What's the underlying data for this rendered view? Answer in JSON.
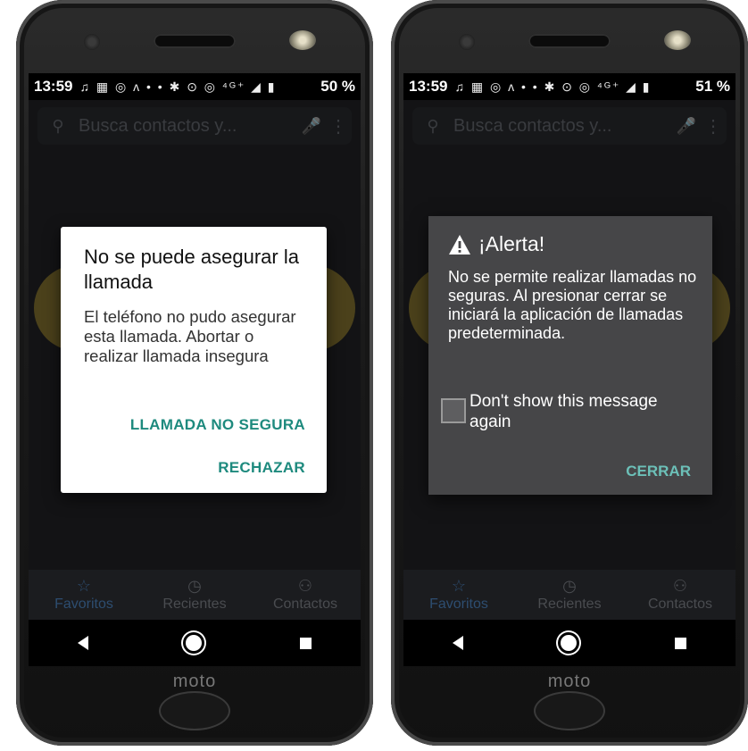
{
  "left_phone": {
    "status": {
      "time": "13:59",
      "icons": "♫ ▦ ◎ ᴧ •   • ✱ ⊙ ◎ ⁴ᴳ⁺ ◢ ▮",
      "battery": "50 %"
    },
    "search_placeholder": "Busca contactos y...",
    "dialog": {
      "title": "No se puede asegurar la llamada",
      "message": "El teléfono no pudo asegurar esta llamada. Abortar o realizar llamada insegura",
      "primary_button": "LLAMADA NO SEGURA",
      "secondary_button": "RECHAZAR",
      "accent_color": "#1e8a7e"
    },
    "bottom_nav": [
      {
        "label": "Favoritos",
        "icon": "star-icon",
        "glyph": "☆"
      },
      {
        "label": "Recientes",
        "icon": "clock-icon",
        "glyph": "◷"
      },
      {
        "label": "Contactos",
        "icon": "people-icon",
        "glyph": "⚇"
      }
    ],
    "brand": "moto"
  },
  "right_phone": {
    "status": {
      "time": "13:59",
      "icons": "♫ ▦ ◎ ᴧ •   • ✱ ⊙ ◎ ⁴ᴳ⁺ ◢ ▮",
      "battery": "51 %"
    },
    "search_placeholder": "Busca contactos y...",
    "dialog": {
      "title": "¡Alerta!",
      "message": "No se permite realizar llamadas no seguras. Al presionar cerrar se iniciará la aplicación de llamadas predeterminada.",
      "checkbox_label": "Don't show this message again",
      "checkbox_checked": false,
      "button": "CERRAR",
      "accent_color": "#6cc0b8"
    },
    "bottom_nav": [
      {
        "label": "Favoritos",
        "icon": "star-icon",
        "glyph": "☆"
      },
      {
        "label": "Recientes",
        "icon": "clock-icon",
        "glyph": "◷"
      },
      {
        "label": "Contactos",
        "icon": "people-icon",
        "glyph": "⚇"
      }
    ],
    "brand": "moto"
  }
}
